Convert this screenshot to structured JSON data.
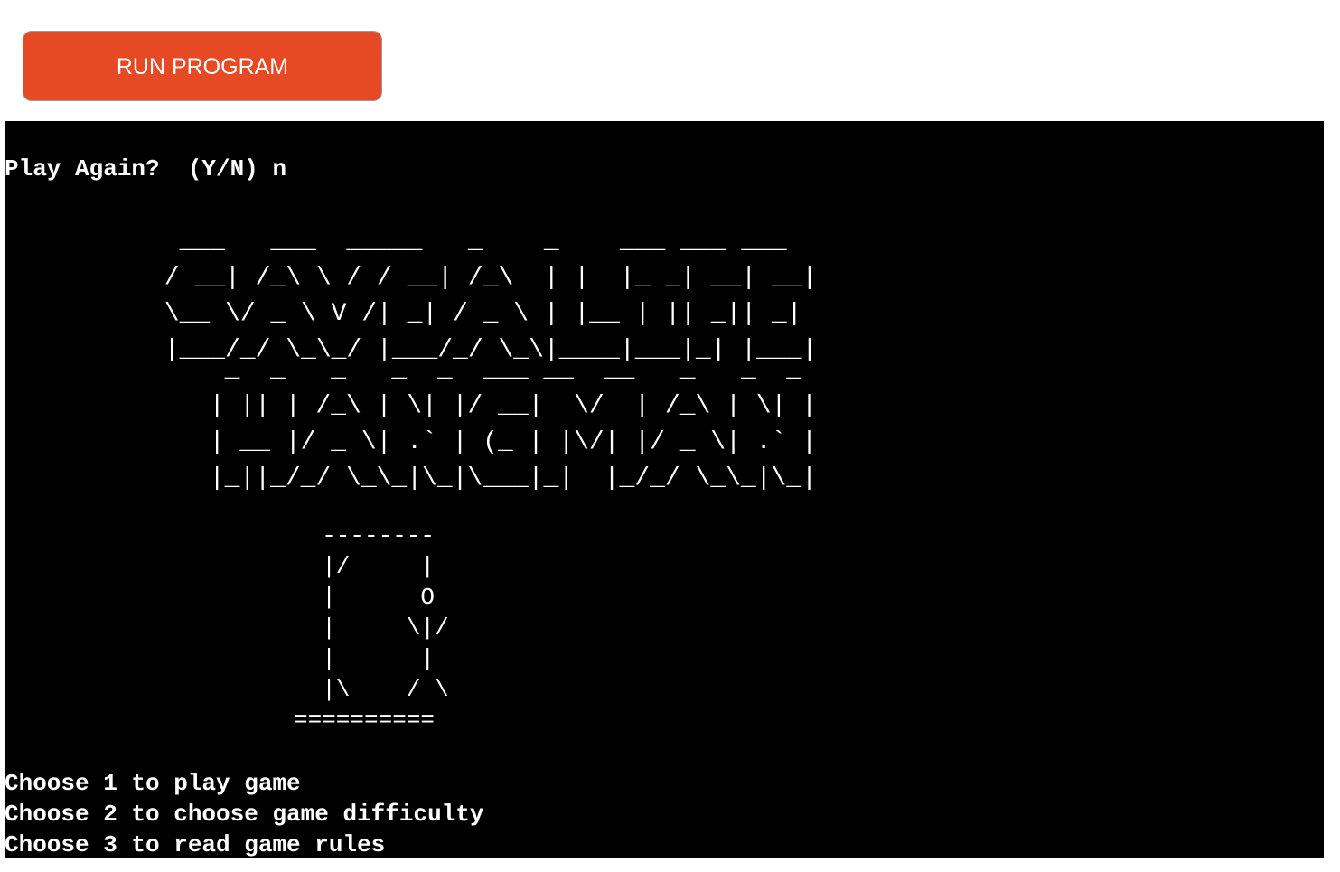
{
  "toolbar": {
    "run_label": "RUN PROGRAM"
  },
  "colors": {
    "accent": "#e64a25",
    "terminal_bg": "#000000",
    "terminal_fg": "#ffffff"
  },
  "terminal": {
    "prompt": "Play Again?  (Y/N) n",
    "title_art_line1": "  ___   ___  _____   _    _    ___ ___ ___ \n / __| /_\\ \\ / / __| /_\\  | |  |_ _| __| __|\n \\__ \\/ _ \\ V /| _| / _ \\ | |__ | || _|| _| \n |___/_/ \\_\\_/ |___/_/ \\_\\|____|___|_| |___|",
    "title_art_line2": "  _  _   _   _  _  ___ __  __   _   _  _ \n | || | /_\\ | \\| |/ __|  \\/  | /_\\ | \\| |\n | __ |/ _ \\| .` | (_ | |\\/| |/ _ \\| .` |\n |_||_/_/ \\_\\_|\\_|\\___|_|  |_/_/ \\_\\_|\\_|",
    "gallows_art": "  --------\n  |/     |\n  |      O\n  |     \\|/\n  |      |\n  |\\    / \\\n==========",
    "menu": [
      "Choose 1 to play game",
      "Choose 2 to choose game difficulty",
      "Choose 3 to read game rules"
    ]
  }
}
